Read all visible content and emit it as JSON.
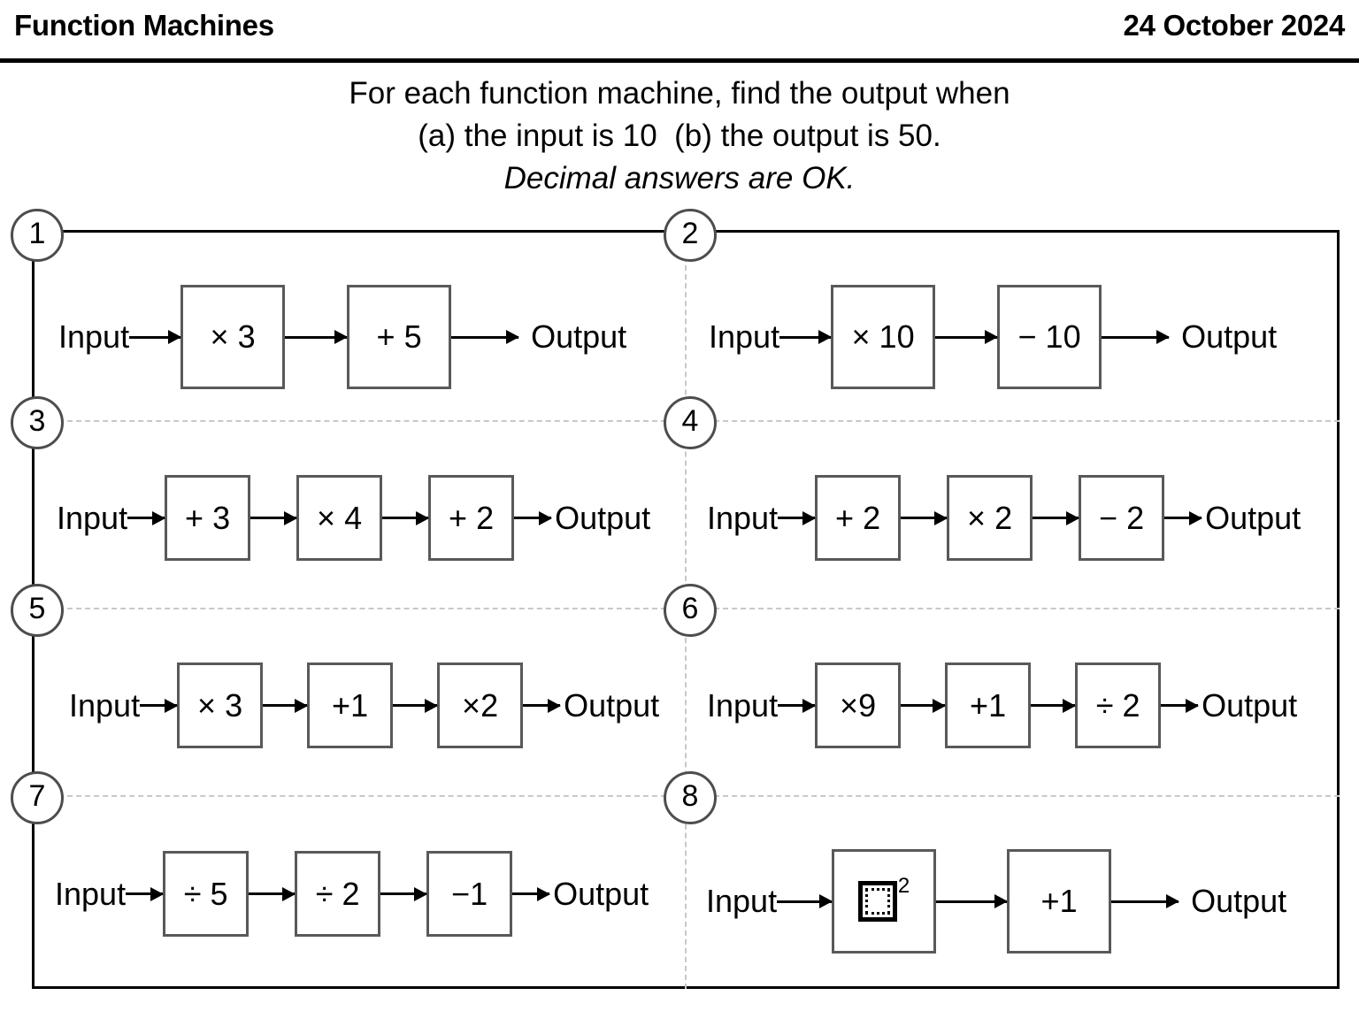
{
  "header": {
    "title": "Function Machines",
    "date": "24 October 2024"
  },
  "instructions": {
    "line1": "For each function machine, find the output when",
    "line2": "(a) the input is 10  (b) the output is 50.",
    "line3": "Decimal answers are OK."
  },
  "labels": {
    "input": "Input",
    "output": "Output"
  },
  "colors": {
    "ink": "#000000",
    "box_border": "#595959",
    "circle_border": "#4d4d4d",
    "divider": "#c8c8c8"
  },
  "machines": [
    {
      "number": "1",
      "operations": [
        "× 3",
        "+ 5"
      ]
    },
    {
      "number": "2",
      "operations": [
        "× 10",
        "− 10"
      ]
    },
    {
      "number": "3",
      "operations": [
        "+ 3",
        "× 4",
        "+ 2"
      ]
    },
    {
      "number": "4",
      "operations": [
        "+ 2",
        "× 2",
        "− 2"
      ]
    },
    {
      "number": "5",
      "operations": [
        "× 3",
        "+1",
        "×2"
      ]
    },
    {
      "number": "6",
      "operations": [
        "×9",
        "+1",
        "÷ 2"
      ]
    },
    {
      "number": "7",
      "operations": [
        "÷ 5",
        "÷ 2",
        "−1"
      ]
    },
    {
      "number": "8",
      "operations": [
        "squared-box-icon",
        "+1"
      ]
    }
  ]
}
